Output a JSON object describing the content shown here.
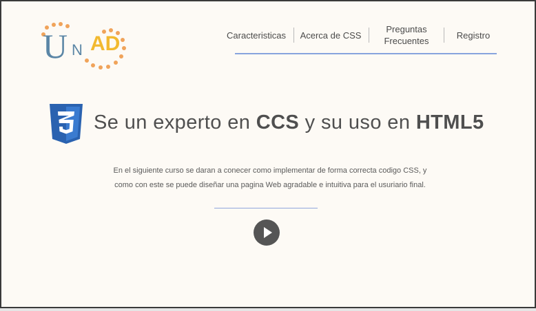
{
  "logo": {
    "letter_u": "U",
    "letter_n": "N",
    "letters_ad": "AD",
    "colors": {
      "primary": "#5b86a6",
      "accent": "#f2b92f",
      "dots": "#f0a35a"
    }
  },
  "nav": {
    "items": [
      {
        "label": "Caracteristicas"
      },
      {
        "label": "Acerca de CSS"
      },
      {
        "label_line1": "Preguntas",
        "label_line2": "Frecuentes"
      },
      {
        "label": "Registro"
      }
    ],
    "underline_color": "#87a3dd"
  },
  "hero": {
    "icon": "css3-shield-icon",
    "title_part1": "Se un experto en ",
    "title_bold1": "CCS",
    "title_part2": " y su uso en ",
    "title_bold2": "HTML5"
  },
  "description": {
    "line1": "En el siguiente curso se daran a conecer como implementar de forma correcta codigo CSS, y",
    "line2": "como con este se puede diseñar una pagina Web agradable e intuitiva para el usuriario final."
  },
  "video": {
    "play_icon": "play-icon"
  }
}
